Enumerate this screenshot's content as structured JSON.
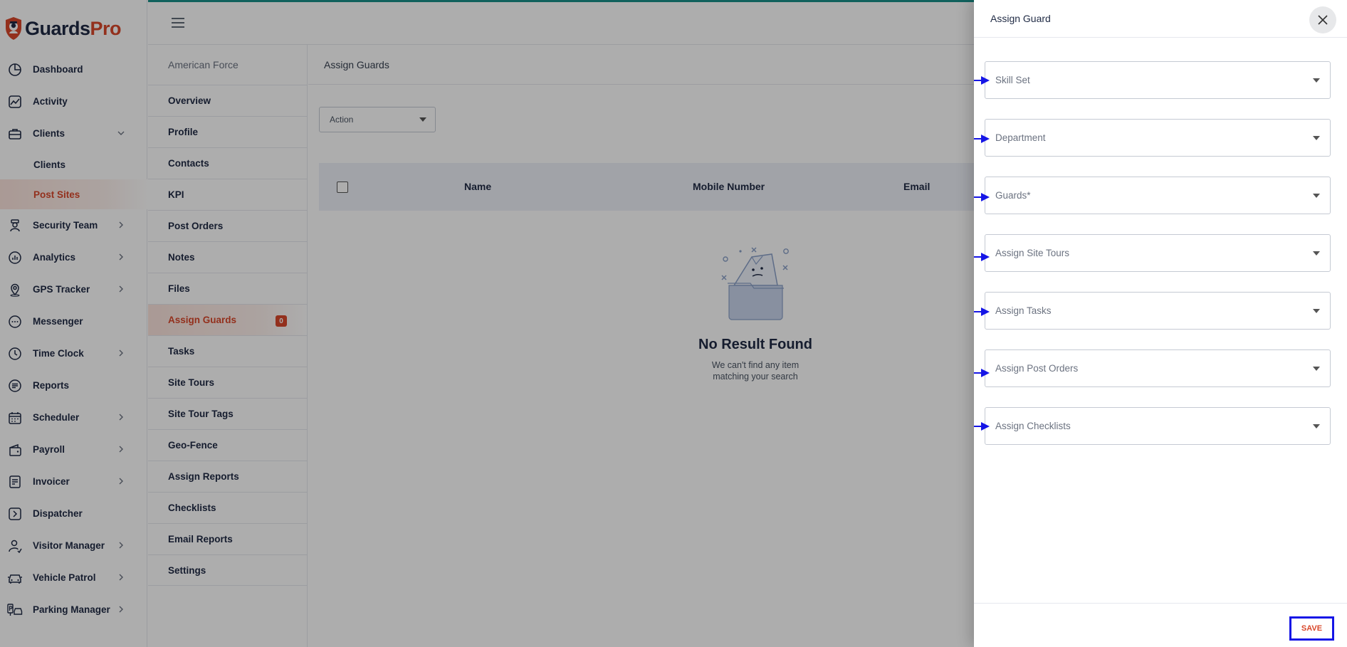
{
  "brand": {
    "name_part1": "Guards",
    "name_part2": "Pro",
    "primary_color": "#1f2a44",
    "accent_color": "#d9482b"
  },
  "sidebar": {
    "items": [
      {
        "label": "Dashboard",
        "icon": "dashboard-icon",
        "has_chevron": false
      },
      {
        "label": "Activity",
        "icon": "activity-icon",
        "has_chevron": false
      },
      {
        "label": "Clients",
        "icon": "briefcase-icon",
        "has_chevron": true,
        "expanded": true
      },
      {
        "label": "Security Team",
        "icon": "guard-icon",
        "has_chevron": true
      },
      {
        "label": "Analytics",
        "icon": "analytics-icon",
        "has_chevron": true
      },
      {
        "label": "GPS Tracker",
        "icon": "location-pin-icon",
        "has_chevron": true
      },
      {
        "label": "Messenger",
        "icon": "chat-icon",
        "has_chevron": false
      },
      {
        "label": "Time Clock",
        "icon": "clock-icon",
        "has_chevron": true
      },
      {
        "label": "Reports",
        "icon": "report-icon",
        "has_chevron": false
      },
      {
        "label": "Scheduler",
        "icon": "calendar-icon",
        "has_chevron": true
      },
      {
        "label": "Payroll",
        "icon": "payroll-icon",
        "has_chevron": true
      },
      {
        "label": "Invoicer",
        "icon": "invoice-icon",
        "has_chevron": true
      },
      {
        "label": "Dispatcher",
        "icon": "dispatch-icon",
        "has_chevron": false
      },
      {
        "label": "Visitor Manager",
        "icon": "visitor-icon",
        "has_chevron": true
      },
      {
        "label": "Vehicle Patrol",
        "icon": "car-icon",
        "has_chevron": true
      },
      {
        "label": "Parking Manager",
        "icon": "parking-icon",
        "has_chevron": true
      }
    ],
    "clients_sub": [
      {
        "label": "Clients",
        "active": false
      },
      {
        "label": "Post Sites",
        "active": true
      }
    ]
  },
  "subnav": {
    "title": "American Force",
    "items": [
      {
        "label": "Overview"
      },
      {
        "label": "Profile"
      },
      {
        "label": "Contacts"
      },
      {
        "label": "KPI"
      },
      {
        "label": "Post Orders"
      },
      {
        "label": "Notes"
      },
      {
        "label": "Files"
      },
      {
        "label": "Assign Guards",
        "active": true,
        "count": "0"
      },
      {
        "label": "Tasks"
      },
      {
        "label": "Site Tours"
      },
      {
        "label": "Site Tour Tags"
      },
      {
        "label": "Geo-Fence"
      },
      {
        "label": "Assign Reports"
      },
      {
        "label": "Checklists"
      },
      {
        "label": "Email Reports"
      },
      {
        "label": "Settings"
      }
    ]
  },
  "main": {
    "title": "Assign Guards",
    "action_label": "Action",
    "columns": [
      "Name",
      "Mobile Number",
      "Email"
    ],
    "empty_title": "No Result Found",
    "empty_line1": "We can't find any item",
    "empty_line2": "matching your search"
  },
  "drawer": {
    "title": "Assign Guard",
    "fields": [
      {
        "placeholder": "Skill Set"
      },
      {
        "placeholder": "Department"
      },
      {
        "placeholder": "Guards*"
      },
      {
        "placeholder": "Assign Site Tours"
      },
      {
        "placeholder": "Assign Tasks"
      },
      {
        "placeholder": "Assign Post Orders"
      },
      {
        "placeholder": "Assign Checklists"
      }
    ],
    "save_label": "SAVE",
    "marker_color": "#1515e6"
  }
}
